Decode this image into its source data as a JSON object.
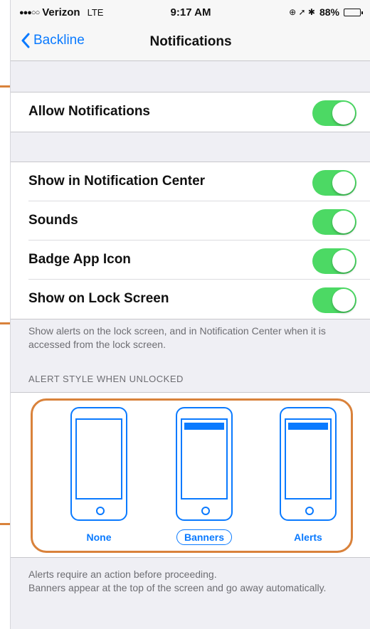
{
  "status_bar": {
    "signal": "●●●○○",
    "carrier": "Verizon",
    "network": "LTE",
    "time": "9:17 AM",
    "icons": "⊕ ➚ ✱",
    "battery": "88%"
  },
  "nav": {
    "back_label": "Backline",
    "title": "Notifications"
  },
  "allow_section": {
    "allow_notifications": {
      "label": "Allow Notifications",
      "on": true
    }
  },
  "options": [
    {
      "label": "Show in Notification Center",
      "on": true
    },
    {
      "label": "Sounds",
      "on": true
    },
    {
      "label": "Badge App Icon",
      "on": true
    },
    {
      "label": "Show on Lock Screen",
      "on": true
    }
  ],
  "lock_screen_footer": "Show alerts on the lock screen, and in Notification Center when it is accessed from the lock screen.",
  "alert_style": {
    "header": "ALERT STYLE WHEN UNLOCKED",
    "styles": [
      {
        "label": "None",
        "selected": false
      },
      {
        "label": "Banners",
        "selected": true
      },
      {
        "label": "Alerts",
        "selected": false
      }
    ]
  },
  "alert_footer": "Alerts require an action before proceeding.\nBanners appear at the top of the screen and go away automatically.",
  "colors": {
    "accent": "#0a7aff",
    "toggle_on": "#4cd964",
    "annotation": "#d9823b"
  }
}
